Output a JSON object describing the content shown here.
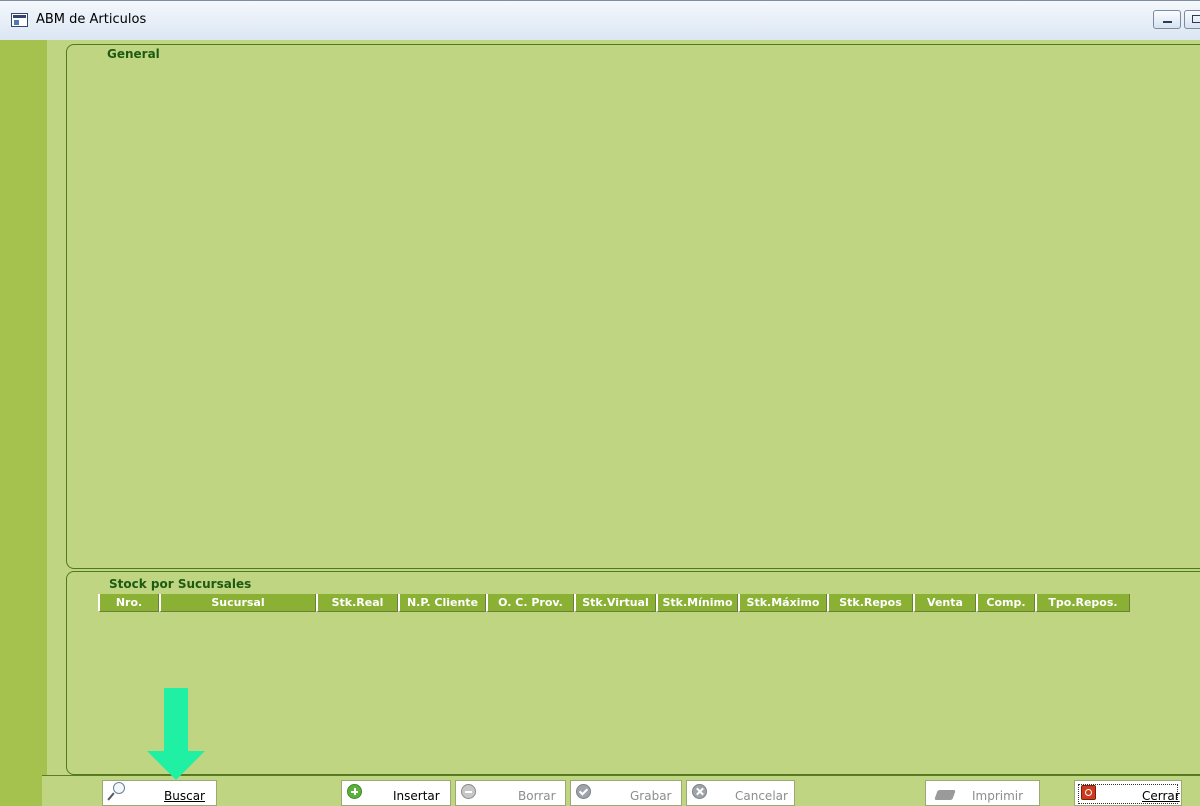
{
  "window": {
    "title": "ABM de Articulos"
  },
  "sections": {
    "general_title": "General",
    "stock_title": "Stock por Sucursales"
  },
  "grid": {
    "columns": [
      "Nro.",
      "Sucursal",
      "Stk.Real",
      "N.P. Cliente",
      "O. C. Prov.",
      "Stk.Virtual",
      "Stk.Mínimo",
      "Stk.Máximo",
      "Stk.Repos",
      "Venta",
      "Comp.",
      "Tpo.Repos."
    ]
  },
  "toolbar": {
    "buscar": "Buscar",
    "insertar": "Insertar",
    "borrar": "Borrar",
    "grabar": "Grabar",
    "cancelar": "Cancelar",
    "imprimir": "Imprimir",
    "cerrar": "Cerrar"
  },
  "annotation": {
    "arrow_color": "#1ff0a3"
  },
  "colors": {
    "client_bg": "#c0d582",
    "left_strip": "#a5c24e",
    "header_bg": "#8ab034",
    "section_title": "#1e5b12"
  }
}
